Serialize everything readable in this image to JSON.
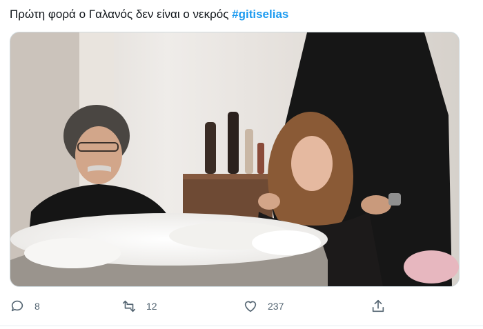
{
  "tweet": {
    "text": "Πρώτη φορά ο Γαλανός δεν είναι ο νεκρός ",
    "hashtag": "#gitiselias"
  },
  "media": {
    "description_icon": "photo"
  },
  "actions": {
    "reply_count": "8",
    "retweet_count": "12",
    "like_count": "237"
  },
  "icons": {
    "reply": "reply-icon",
    "retweet": "retweet-icon",
    "like": "like-icon",
    "share": "share-icon"
  },
  "colors": {
    "accent": "#1d9bf0",
    "icon": "#536471"
  }
}
